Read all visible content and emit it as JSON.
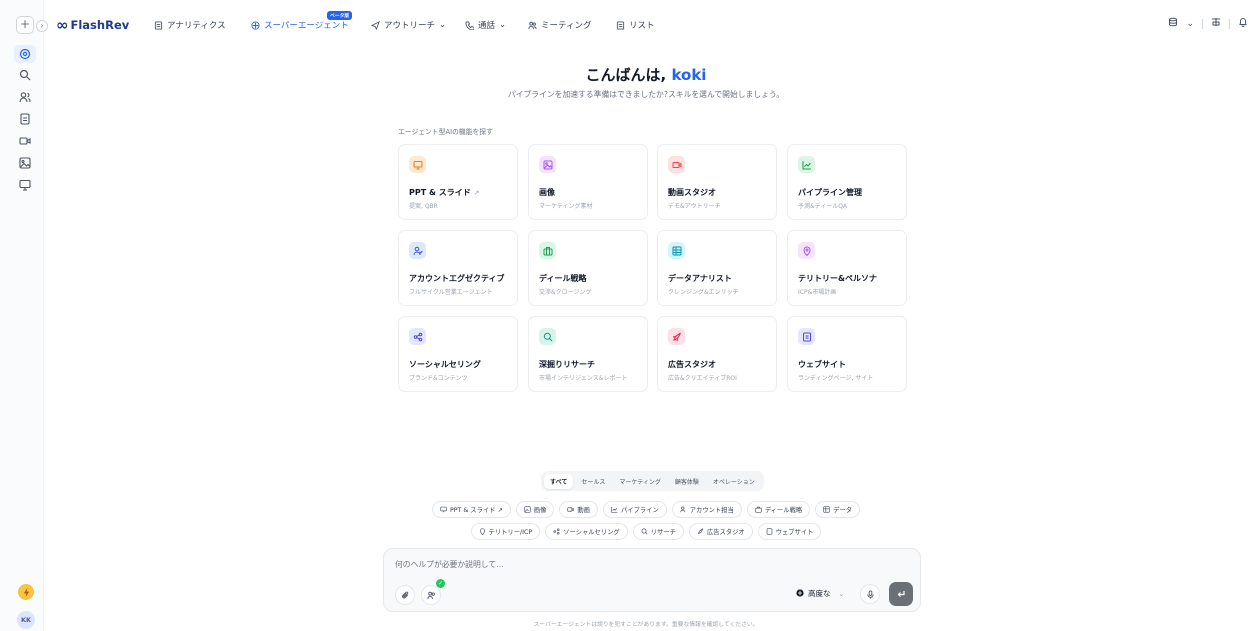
{
  "nav": {
    "logo": "FlashRev",
    "items": [
      {
        "label": "アナリティクス",
        "icon": "doc-icon"
      },
      {
        "label": "スーパーエージェント",
        "icon": "agent-icon"
      },
      {
        "label": "アウトリーチ",
        "icon": "outreach-icon"
      },
      {
        "label": "通話",
        "icon": "phone-icon"
      },
      {
        "label": "ミーティング",
        "icon": "meeting-icon"
      },
      {
        "label": "リスト",
        "icon": "list-icon"
      }
    ],
    "beta": "ベータ版",
    "caret": "⌄"
  },
  "rail": {
    "plus": "+",
    "collapse": "›",
    "avatar": "KK"
  },
  "hero": {
    "greeting": "こんばんは, ",
    "name": "koki",
    "subtitle": "パイプラインを加速する準備はできましたか?スキルを選んで開始しましょう。"
  },
  "section_label": "エージェント型AIの機能を探す",
  "cards": [
    {
      "title": "PPT & スライド",
      "desc": "提案, QBR",
      "ext": "↗"
    },
    {
      "title": "画像",
      "desc": "マーケティング素材"
    },
    {
      "title": "動画スタジオ",
      "desc": "デモ&アウトリーチ"
    },
    {
      "title": "パイプライン管理",
      "desc": "予測&ディールQA"
    },
    {
      "title": "アカウントエグゼクティブ",
      "desc": "フルサイクル営業エージェント"
    },
    {
      "title": "ディール戦略",
      "desc": "交渉&クロージング"
    },
    {
      "title": "データアナリスト",
      "desc": "クレンジング&エンリッチ"
    },
    {
      "title": "テリトリー&ペルソナ",
      "desc": "ICP&市場計画"
    },
    {
      "title": "ソーシャルセリング",
      "desc": "ブランド&コンテンツ"
    },
    {
      "title": "深掘りリサーチ",
      "desc": "市場インテリジェンス&レポート"
    },
    {
      "title": "広告スタジオ",
      "desc": "広告&クリエイティブROI"
    },
    {
      "title": "ウェブサイト",
      "desc": "ランディングページ, サイト"
    }
  ],
  "tabs": [
    "すべて",
    "セールス",
    "マーケティング",
    "顧客体験",
    "オペレーション"
  ],
  "chips_row1": [
    {
      "label": "PPT & スライド ↗",
      "icon": "slides-icon"
    },
    {
      "label": "画像",
      "icon": "image-icon"
    },
    {
      "label": "動画",
      "icon": "video-icon"
    },
    {
      "label": "パイプライン",
      "icon": "chart-icon"
    },
    {
      "label": "アカウント担当",
      "icon": "user-icon"
    },
    {
      "label": "ディール戦略",
      "icon": "briefcase-icon"
    },
    {
      "label": "データ",
      "icon": "table-icon"
    }
  ],
  "chips_row2": [
    {
      "label": "テリトリー/ICP",
      "icon": "pin-icon"
    },
    {
      "label": "ソーシャルセリング",
      "icon": "share-icon"
    },
    {
      "label": "リサーチ",
      "icon": "search-icon"
    },
    {
      "label": "広告スタジオ",
      "icon": "rocket-icon"
    },
    {
      "label": "ウェブサイト",
      "icon": "web-icon"
    }
  ],
  "composer": {
    "placeholder": "何のヘルプが必要か説明して...",
    "mode": "高度な"
  },
  "footnote": "スーパーエージェントは誤りを犯すことがあります。重要な情報を確認してください。"
}
